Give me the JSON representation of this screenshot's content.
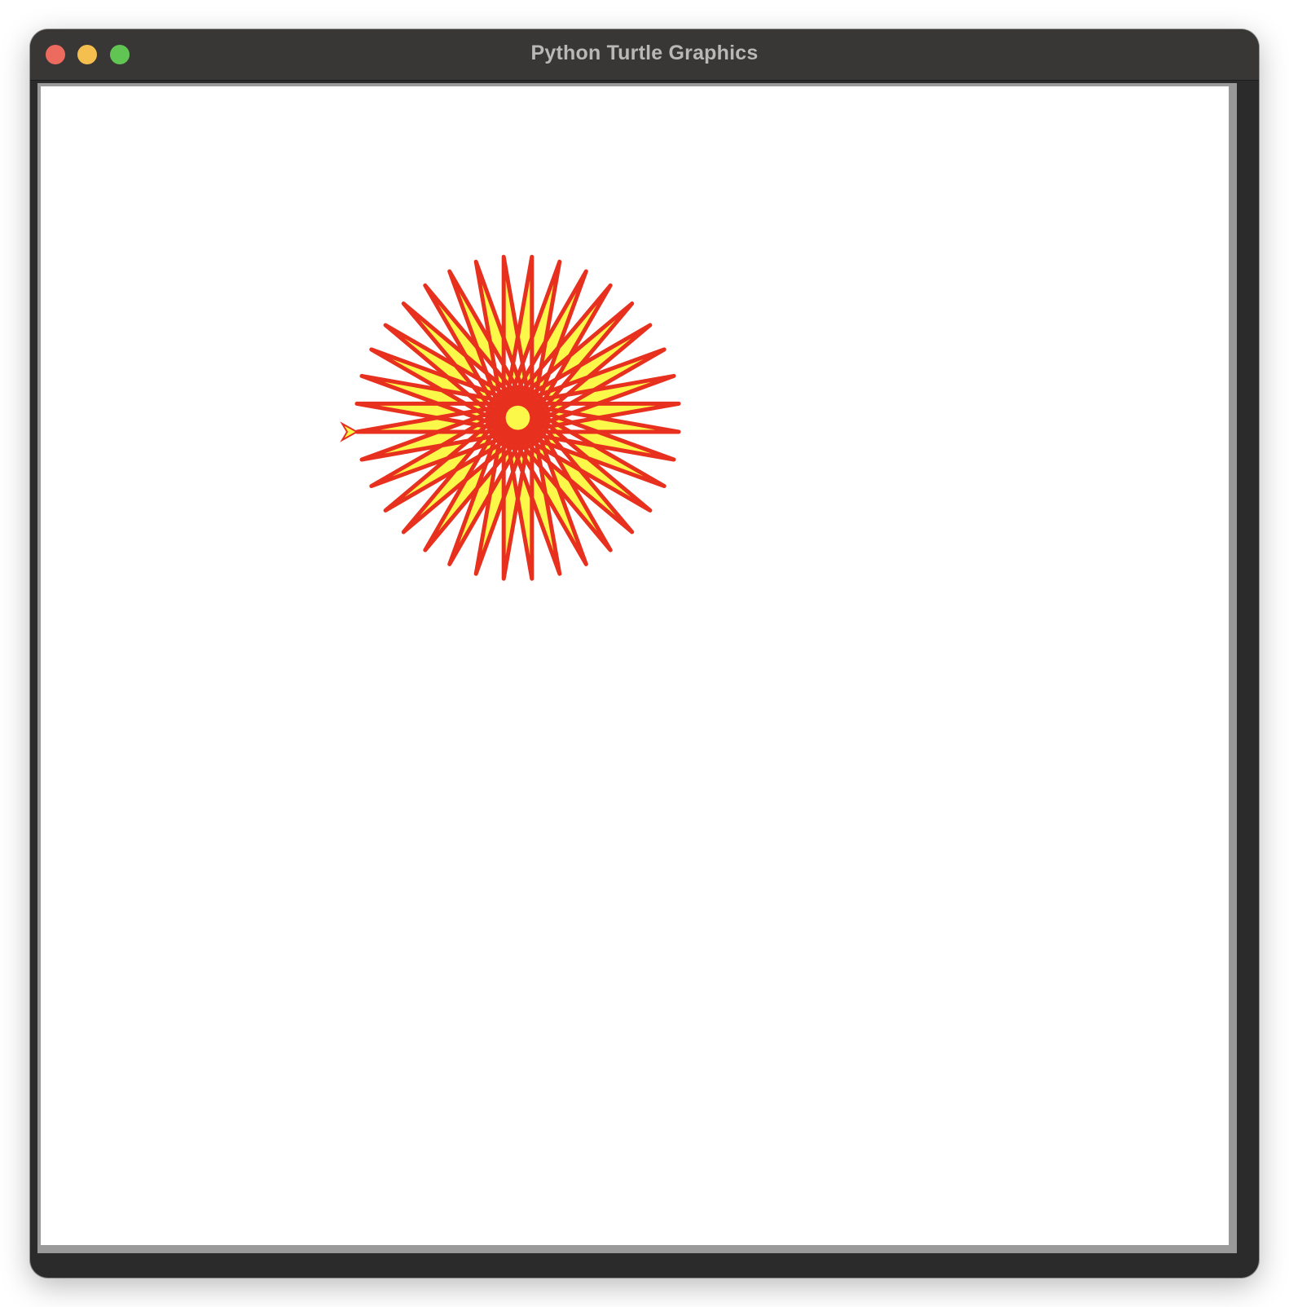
{
  "window": {
    "title": "Python Turtle Graphics",
    "buttons": {
      "close_color": "#ed6a5e",
      "minimize_color": "#f4bf4f",
      "zoom_color": "#61c554"
    }
  },
  "drawing": {
    "shape": "star",
    "points": 36,
    "pen_color": "#e8301f",
    "fill_color": "#fbf84a",
    "turtle_icon": "arrow-turtle-icon"
  }
}
